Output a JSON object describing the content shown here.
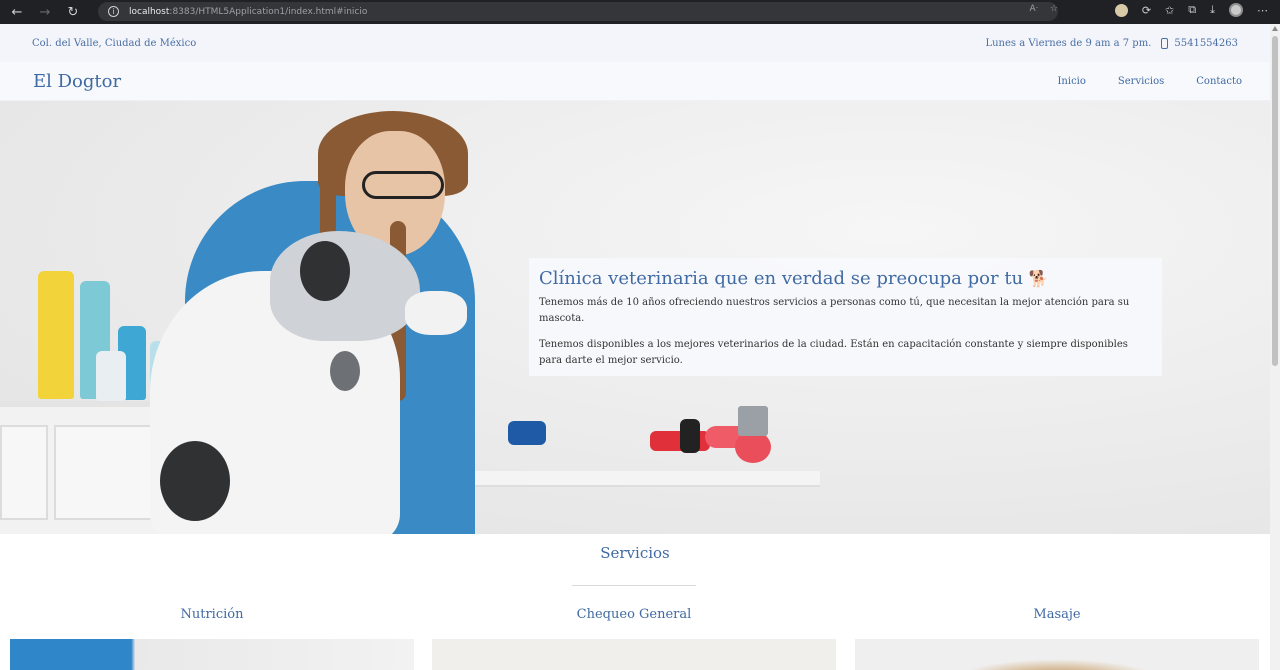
{
  "browser": {
    "url_host": "localhost",
    "url_rest": ":8383/HTML5Application1/index.html#inicio"
  },
  "topbar": {
    "address": "Col. del Valle, Ciudad de México",
    "hours": "Lunes a Viernes de 9 am a 7 pm.",
    "phone": "5541554263"
  },
  "navbar": {
    "brand": "El Dogtor",
    "menu": [
      "Inicio",
      "Servicios",
      "Contacto"
    ]
  },
  "hero": {
    "title": "Clínica veterinaria que en verdad se preocupa por tu",
    "emoji": "🐕",
    "paragraph1": "Tenemos más de 10 años ofreciendo nuestros servicios a personas como tú, que necesitan la mejor atención para su mascota.",
    "paragraph2": "Tenemos disponibles a los mejores veterinarios de la ciudad. Están en capacitación constante y siempre disponibles para darte el mejor servicio."
  },
  "services": {
    "heading": "Servicios",
    "items": [
      {
        "title": "Nutrición"
      },
      {
        "title": "Chequeo General"
      },
      {
        "title": "Masaje"
      }
    ]
  },
  "colors": {
    "accent": "#3f6aa3",
    "topbar_bg": "#f3f5fa",
    "browser_bg": "#202124"
  }
}
